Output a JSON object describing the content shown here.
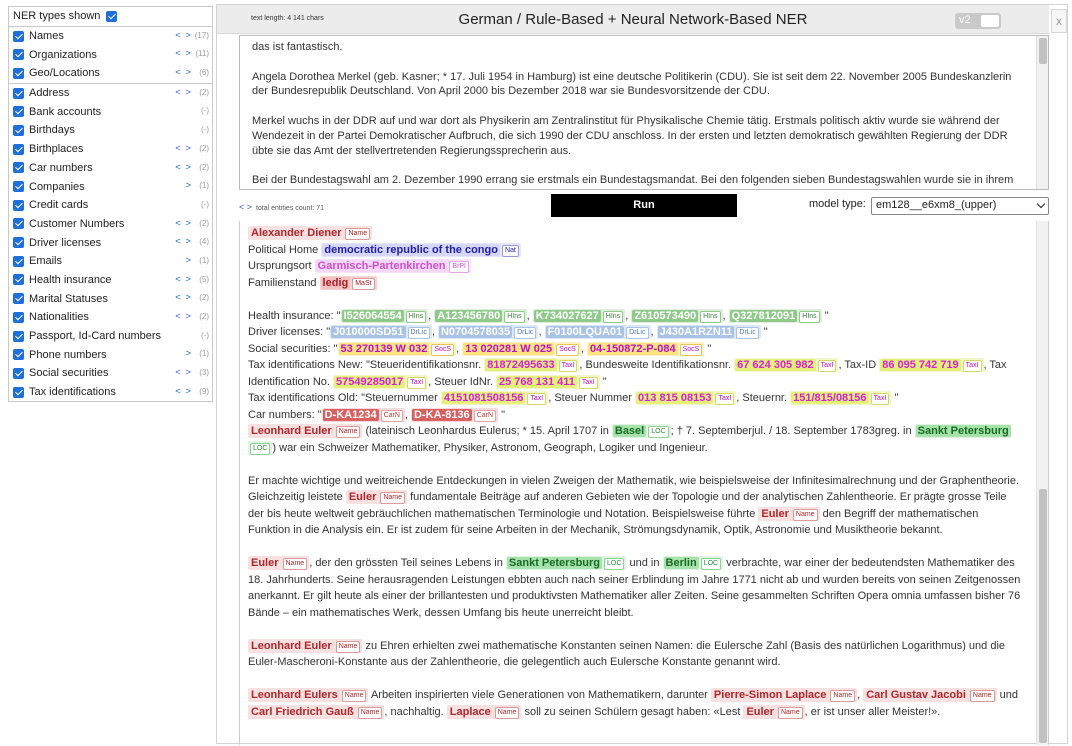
{
  "sidebar": {
    "header": "NER types shown",
    "groups": [
      [
        {
          "label": "Names",
          "nav": "< >",
          "count": "(17)"
        },
        {
          "label": "Organizations",
          "nav": "< >",
          "count": "(11)"
        },
        {
          "label": "Geo/Locations",
          "nav": "< >",
          "count": "(6)"
        }
      ],
      [
        {
          "label": "Address",
          "nav": "< >",
          "count": "(2)"
        },
        {
          "label": "Bank accounts",
          "nav": "",
          "count": "(-)"
        },
        {
          "label": "Birthdays",
          "nav": "",
          "count": "(-)"
        },
        {
          "label": "Birthplaces",
          "nav": "< >",
          "count": "(2)"
        },
        {
          "label": "Car numbers",
          "nav": "< >",
          "count": "(2)"
        },
        {
          "label": "Companies",
          "nav": ">",
          "count": "(1)"
        },
        {
          "label": "Credit cards",
          "nav": "",
          "count": "(-)"
        },
        {
          "label": "Customer Numbers",
          "nav": "< >",
          "count": "(2)"
        },
        {
          "label": "Driver licenses",
          "nav": "< >",
          "count": "(4)"
        },
        {
          "label": "Emails",
          "nav": ">",
          "count": "(1)"
        },
        {
          "label": "Health insurance",
          "nav": "< >",
          "count": "(5)"
        },
        {
          "label": "Marital Statuses",
          "nav": "< >",
          "count": "(2)"
        },
        {
          "label": "Nationalities",
          "nav": "< >",
          "count": "(2)"
        },
        {
          "label": "Passport, Id-Card numbers",
          "nav": "",
          "count": "(-)"
        },
        {
          "label": "Phone numbers",
          "nav": ">",
          "count": "(1)"
        },
        {
          "label": "Social securities",
          "nav": "< >",
          "count": "(3)"
        },
        {
          "label": "Tax identifications",
          "nav": "< >",
          "count": "(9)"
        }
      ]
    ]
  },
  "toolbar": {
    "text_length": "text length: 4 141 chars",
    "title": "German / Rule-Based + Neural Network-Based NER",
    "version_label": "v2",
    "close": "x"
  },
  "input": {
    "paragraphs": [
      "das ist fantastisch.",
      "Angela Dorothea Merkel (geb. Kasner; * 17. Juli 1954 in Hamburg) ist eine deutsche Politikerin (CDU). Sie ist seit dem 22. November 2005 Bundeskanzlerin der Bundesrepublik Deutschland. Von April 2000 bis Dezember 2018 war sie Bundesvorsitzende der CDU.",
      "Merkel wuchs in der DDR auf und war dort als Physikerin am Zentralinstitut für Physikalische Chemie tätig. Erstmals politisch aktiv wurde sie während der Wendezeit in der Partei Demokratischer Aufbruch, die sich 1990 der CDU anschloss. In der ersten und letzten demokratisch gewählten Regierung der DDR übte sie das Amt der stellvertretenden Regierungssprecherin aus.",
      "Bei der Bundestagswahl am 2. Dezember 1990 errang sie erstmals ein Bundestagsmandat. Bei den folgenden sieben Bundestagswahlen wurde sie in ihrem Wahlkreis in Vorpommern direkt gewählt. Von 1991 bis 1994 war Merkel Bundesministerin für Frauen und Jugend im Kabinett Kohl IV und von 1994 bis 1998"
    ]
  },
  "controls": {
    "nav_arrows": "< >",
    "entities_count": "total entities count: 71",
    "run_label": "Run",
    "model_type_label": "model type:",
    "model_value": "em128__e6xm8_(upper)"
  },
  "output": {
    "name1": "Alexander Diener",
    "tag_name": "Name",
    "polhome_label": "Political Home",
    "polhome_val": "democratic republic of the congo",
    "tag_nat": "Nat",
    "orig_label": "Ursprungsort",
    "orig_val": "Garmisch-Partenkirchen",
    "tag_brpl": "BrPl",
    "fam_label": "Familienstand",
    "fam_val": "ledig",
    "tag_mast": "MaSt",
    "hi_label": "Health insurance: \"",
    "hi": [
      "I526064554",
      "A123456780",
      "K734027627",
      "Z610573490",
      "Q327812091"
    ],
    "tag_hi": "HIns",
    "dl_label": "Driver licenses: \"",
    "dl": [
      "J010000SD51",
      "N0704578035",
      "F0100LQUA01",
      "J430A1RZN11"
    ],
    "tag_dl": "DrLic",
    "ss_label": "Social securities: \"",
    "ss": [
      "53 270139 W 032",
      "13 020281 W 025",
      "04-150872-P-084"
    ],
    "tag_ss": "SocS",
    "tax_new_label": "Tax identifications New: \"Steueridentifikationsnr.",
    "tax_new_1": "81872495633",
    "tax_new_mid1": ", Bundesweite Identifikationsnr.",
    "tax_new_2": "67 624 305 982",
    "tax_new_mid2": ", Tax-ID",
    "tax_new_3": "86 095 742 719",
    "tax_new_mid3": ", Tax Identification No.",
    "tax_new_4": "57549285017",
    "tax_new_mid4": ", Steuer IdNr.",
    "tax_new_5": "25 768 131 411",
    "tag_tax": "TaxI",
    "tax_old_label": "Tax identifications Old: \"Steuernummer",
    "tax_old_1": "4151081508156",
    "tax_old_mid1": ", Steuer Nummer",
    "tax_old_2": "013 815 08153",
    "tax_old_mid2": ", Steuernr.",
    "tax_old_3": "151/815/08156",
    "car_label": "Car numbers: \"",
    "car": [
      "D-KA1234",
      "D-KA-8136"
    ],
    "tag_car": "CarN",
    "euler_full": "Leonhard Euler",
    "euler_p1a": "(lateinisch Leonhardus Eulerus; * 15. April 1707 in",
    "basel": "Basel",
    "tag_loc": "LOC",
    "euler_p1b": "; † 7. Septemberjul. / 18. September 1783greg. in",
    "spb": "Sankt Petersburg",
    "euler_p1c": ") war ein Schweizer Mathematiker, Physiker, Astronom, Geograph, Logiker und Ingenieur.",
    "p2a": "Er machte wichtige und weitreichende Entdeckungen in vielen Zweigen der Mathematik, wie beispielsweise der Infinitesimalrechnung und der Graphentheorie. Gleichzeitig leistete",
    "euler": "Euler",
    "p2b": "fundamentale Beiträge auf anderen Gebieten wie der Topologie und der analytischen Zahlentheorie. Er prägte grosse Teile der bis heute weltweit gebräuchlichen mathematischen Terminologie und Notation. Beispielsweise führte",
    "p2c": "den Begriff der mathematischen Funktion in die Analysis ein. Er ist zudem für seine Arbeiten in der Mechanik, Strömungsdynamik, Optik, Astronomie und Musiktheorie bekannt.",
    "p3a": ", der den grössten Teil seines Lebens in",
    "p3b": "und in",
    "berlin": "Berlin",
    "p3c": "verbrachte, war einer der bedeutendsten Mathematiker des 18. Jahrhunderts. Seine herausragenden Leistungen ebbten auch nach seiner Erblindung im Jahre 1771 nicht ab und wurden bereits von seinen Zeitgenossen anerkannt. Er gilt heute als einer der brillantesten und produktivsten Mathematiker aller Zeiten. Seine gesammelten Schriften Opera omnia umfassen bisher 76 Bände – ein mathematisches Werk, dessen Umfang bis heute unerreicht bleibt.",
    "p4a": "zu Ehren erhielten zwei mathematische Konstanten seinen Namen: die Eulersche Zahl (Basis des natürlichen Logarithmus) und die Euler-Mascheroni-Konstante aus der Zahlentheorie, die gelegentlich auch Eulersche Konstante genannt wird.",
    "eulers": "Leonhard Eulers",
    "p5a": "Arbeiten inspirierten viele Generationen von Mathematikern, darunter",
    "laplace_full": "Pierre-Simon Laplace",
    "jacobi": "Carl Gustav Jacobi",
    "p5b": "und",
    "gauss": "Carl Friedrich Gauß",
    "p5c": ", nachhaltig.",
    "laplace": "Laplace",
    "p5d": "soll zu seinen Schülern gesagt haben: «Lest",
    "p5e": ", er ist unser aller Meister!»."
  }
}
